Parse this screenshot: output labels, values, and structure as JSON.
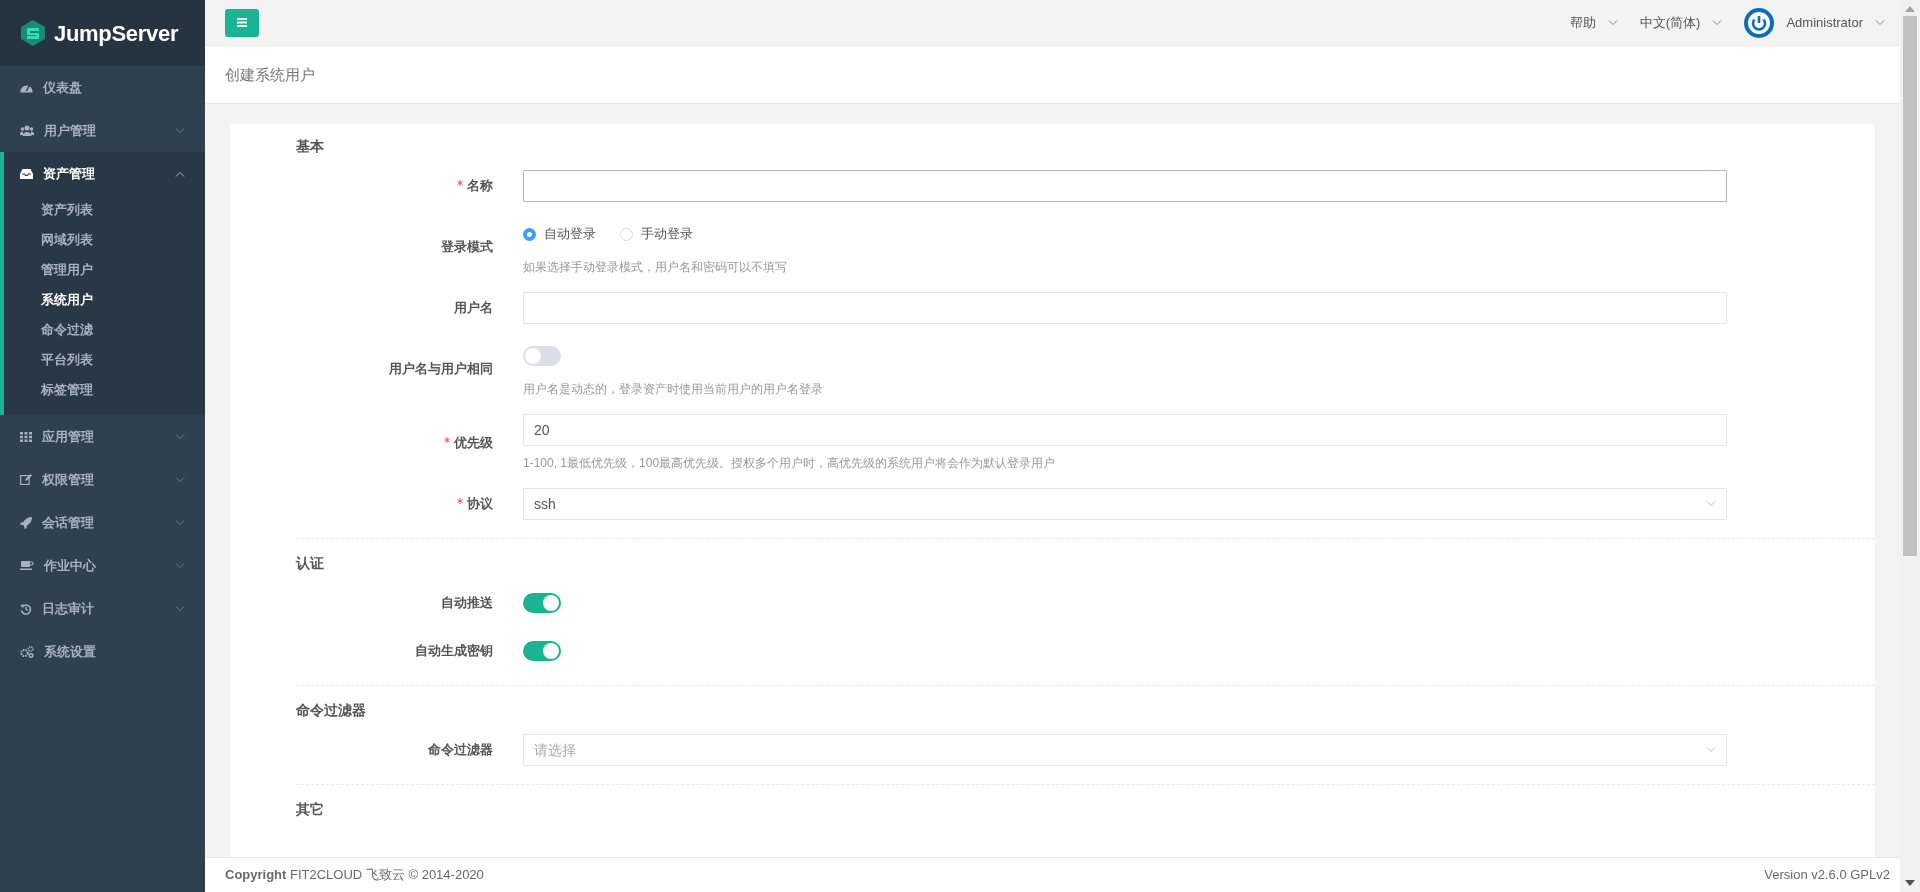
{
  "logo": {
    "text": "JumpServer"
  },
  "sidebar": {
    "items": [
      {
        "label": "仪表盘",
        "kind": "link"
      },
      {
        "label": "用户管理",
        "kind": "group",
        "expanded": false
      },
      {
        "label": "资产管理",
        "kind": "group",
        "expanded": true,
        "children": [
          {
            "label": "资产列表",
            "selected": false
          },
          {
            "label": "网域列表",
            "selected": false
          },
          {
            "label": "管理用户",
            "selected": false
          },
          {
            "label": "系统用户",
            "selected": true
          },
          {
            "label": "命令过滤",
            "selected": false
          },
          {
            "label": "平台列表",
            "selected": false
          },
          {
            "label": "标签管理",
            "selected": false
          }
        ]
      },
      {
        "label": "应用管理",
        "kind": "group",
        "expanded": false
      },
      {
        "label": "权限管理",
        "kind": "group",
        "expanded": false
      },
      {
        "label": "会话管理",
        "kind": "group",
        "expanded": false
      },
      {
        "label": "作业中心",
        "kind": "group",
        "expanded": false
      },
      {
        "label": "日志审计",
        "kind": "group",
        "expanded": false
      },
      {
        "label": "系统设置",
        "kind": "link"
      }
    ]
  },
  "topbar": {
    "menus": [
      {
        "label": "帮助",
        "kind": "text"
      },
      {
        "label": "中文(简体)",
        "kind": "text"
      },
      {
        "label": "Administrator",
        "kind": "user"
      }
    ]
  },
  "page_title": "创建系统用户",
  "sections": [
    {
      "title": "基本",
      "fields": [
        {
          "kind": "input",
          "label": "名称",
          "required": true,
          "focused": true
        },
        {
          "kind": "radio",
          "label": "登录模式",
          "required": false,
          "options": [
            {
              "label": "自动登录",
              "selected": true
            },
            {
              "label": "手动登录",
              "selected": false
            }
          ],
          "help": "如果选择手动登录模式，用户名和密码可以不填写"
        },
        {
          "kind": "input",
          "label": "用户名",
          "required": false,
          "focused": false
        },
        {
          "kind": "switch",
          "label": "用户名与用户相同",
          "required": false,
          "on": false,
          "help": "用户名是动态的，登录资产时使用当前用户的用户名登录"
        },
        {
          "kind": "input",
          "label": "优先级",
          "required": true,
          "focused": false,
          "value": "20",
          "help": "1-100, 1最低优先级，100最高优先级。授权多个用户时，高优先级的系统用户将会作为默认登录用户"
        },
        {
          "kind": "select",
          "label": "协议",
          "required": true,
          "value": "ssh"
        }
      ]
    },
    {
      "title": "认证",
      "fields": [
        {
          "kind": "switch",
          "label": "自动推送",
          "required": false,
          "on": true
        },
        {
          "kind": "switch",
          "label": "自动生成密钥",
          "required": false,
          "on": true
        }
      ]
    },
    {
      "title": "命令过滤器",
      "fields": [
        {
          "kind": "select",
          "label": "命令过滤器",
          "required": false,
          "placeholder": "请选择"
        }
      ]
    },
    {
      "title": "其它"
    }
  ],
  "footer": {
    "copyright": "**Copyright** FIT2CLOUD 飞致云 © 2014-2020",
    "version": "Version v2.6.0 GPLv2"
  }
}
